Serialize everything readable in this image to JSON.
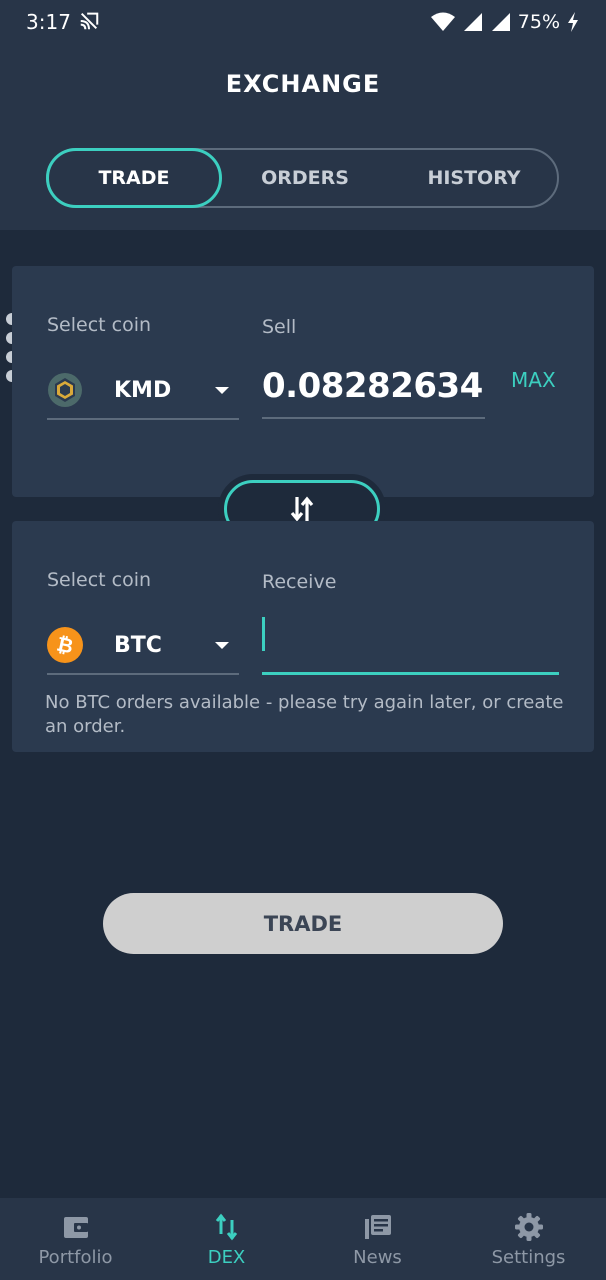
{
  "status_bar": {
    "time": "3:17",
    "battery": "75%",
    "icons": [
      "cast-off-icon",
      "wifi-icon",
      "signal-icon",
      "signal-icon",
      "charging-icon"
    ]
  },
  "header": {
    "title": "EXCHANGE",
    "tabs": [
      {
        "label": "TRADE",
        "active": true
      },
      {
        "label": "ORDERS",
        "active": false
      },
      {
        "label": "HISTORY",
        "active": false
      }
    ]
  },
  "sell": {
    "select_label": "Select coin",
    "coin": "KMD",
    "amount_label": "Sell",
    "amount": "0.08282634",
    "max_label": "MAX"
  },
  "receive": {
    "select_label": "Select coin",
    "coin": "BTC",
    "amount_label": "Receive",
    "amount": "",
    "hint": "No BTC orders available - please try again later, or create an order."
  },
  "trade_button": "TRADE",
  "bottom_nav": [
    {
      "label": "Portfolio",
      "icon": "wallet-icon",
      "active": false
    },
    {
      "label": "DEX",
      "icon": "swap-vertical-icon",
      "active": true
    },
    {
      "label": "News",
      "icon": "news-icon",
      "active": false
    },
    {
      "label": "Settings",
      "icon": "gear-icon",
      "active": false
    }
  ],
  "colors": {
    "background": "#1e2a3b",
    "surface": "#2b3a4f",
    "header": "#283548",
    "accent": "#3ccfc0",
    "btc": "#f7931a",
    "button_disabled": "#cfcfcf"
  }
}
